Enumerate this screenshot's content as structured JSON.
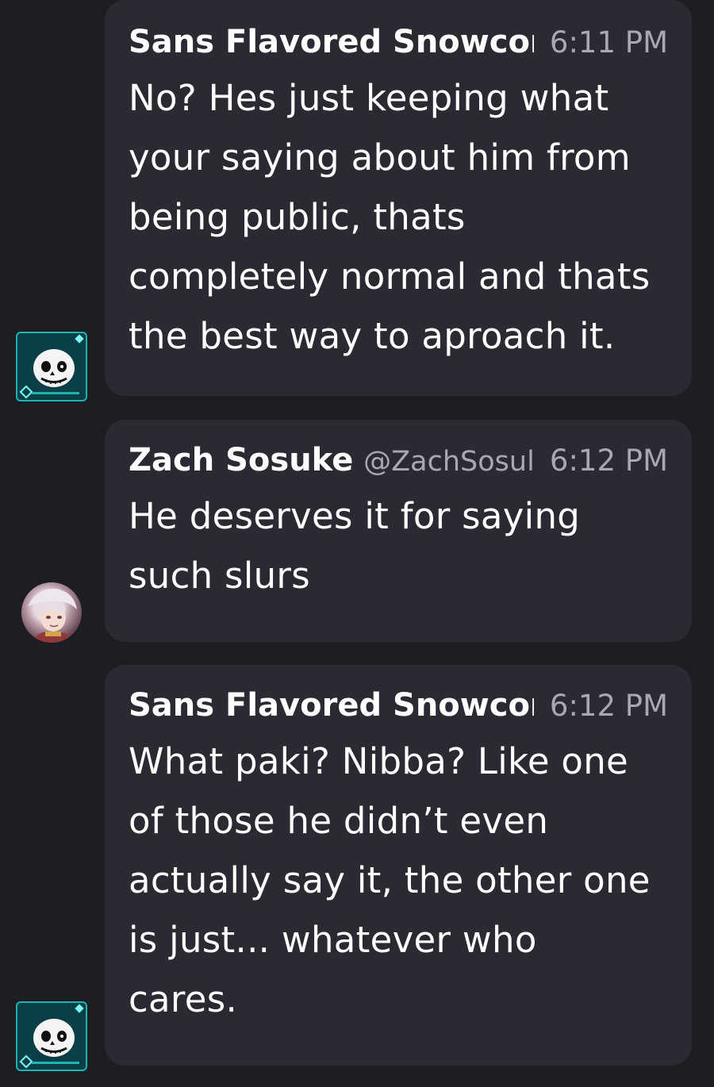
{
  "messages": [
    {
      "author": "Sans Flavored Snowcone",
      "author_display": "Sans Flavored Snowcor",
      "handle": "",
      "time": "6:11 PM",
      "avatar": "sans-skull-avatar",
      "lines": [
        "No? Hes just keeping what",
        "your saying about him from",
        "being public, thats",
        "completely normal and thats",
        "the best way to aproach it."
      ]
    },
    {
      "author": "Zach Sosuke",
      "handle": "@ZachSosul",
      "time": "6:12 PM",
      "avatar": "anime-character-avatar",
      "lines": [
        "He deserves it for saying",
        "such slurs"
      ]
    },
    {
      "author": "Sans Flavored Snowcone",
      "author_display": "Sans Flavored Snowcor",
      "handle": "",
      "time": "6:12 PM",
      "avatar": "sans-skull-avatar",
      "lines": [
        "What paki? Nibba? Like one",
        "of those he didn’t even",
        "actually say it, the other one",
        "is just... whatever who",
        "cares."
      ]
    }
  ],
  "colors": {
    "background": "#1e1d24",
    "bubble": "#2b2a32",
    "muted_text": "#a9a8b0",
    "avatar_frame": "#1fb3b3"
  }
}
